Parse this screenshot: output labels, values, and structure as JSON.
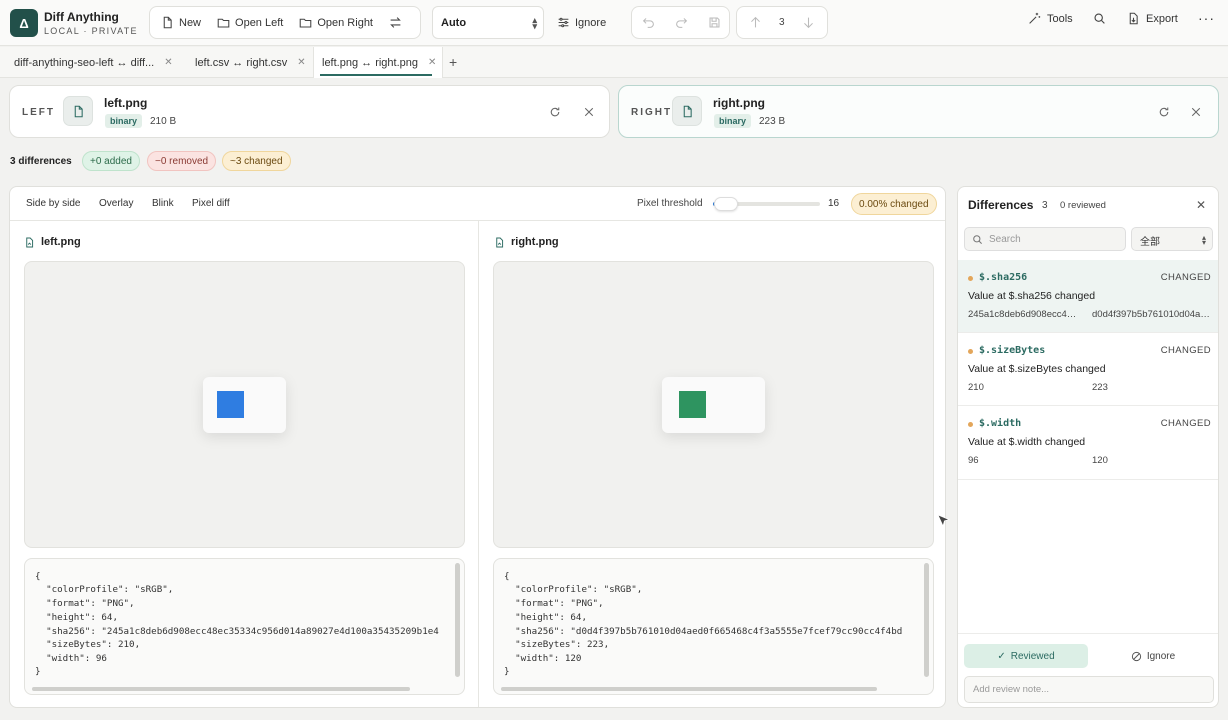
{
  "app": {
    "logo_glyph": "Δ",
    "title": "Diff Anything",
    "subtitle": "LOCAL · PRIVATE"
  },
  "toolbar": {
    "new_label": "New",
    "open_left_label": "Open Left",
    "open_right_label": "Open Right",
    "mode_select": "Auto",
    "ignore_label": "Ignore",
    "diff_index": "3",
    "tools_label": "Tools",
    "export_label": "Export"
  },
  "tabs": [
    {
      "label": "diff-anything-seo-left ↔ diff...",
      "active": false
    },
    {
      "label": "left.csv ↔ right.csv",
      "active": false
    },
    {
      "label": "left.png ↔ right.png",
      "active": true
    }
  ],
  "left_file": {
    "side": "LEFT",
    "name": "left.png",
    "type": "binary",
    "size": "210 B"
  },
  "right_file": {
    "side": "RIGHT",
    "name": "right.png",
    "type": "binary",
    "size": "223 B"
  },
  "summary": {
    "title": "3 differences",
    "added": "+0 added",
    "removed": "−0 removed",
    "changed": "~3 changed"
  },
  "view_modes": [
    "Side by side",
    "Overlay",
    "Blink",
    "Pixel diff"
  ],
  "pixel_threshold": {
    "label": "Pixel threshold",
    "value": "16",
    "changed": "0.00% changed"
  },
  "left_pane": {
    "title": "left.png",
    "swatch_color": "#2f7de1",
    "json": [
      "{",
      "  \"colorProfile\": \"sRGB\",",
      "  \"format\": \"PNG\",",
      "  \"height\": 64,",
      "  \"sha256\": \"245a1c8deb6d908ecc48ec35334c956d014a89027e4d100a35435209b1e4",
      "  \"sizeBytes\": 210,",
      "  \"width\": 96",
      "}"
    ]
  },
  "right_pane": {
    "title": "right.png",
    "swatch_color": "#2e9460",
    "json": [
      "{",
      "  \"colorProfile\": \"sRGB\",",
      "  \"format\": \"PNG\",",
      "  \"height\": 64,",
      "  \"sha256\": \"d0d4f397b5b761010d04aed0f665468c4f3a5555e7fcef79cc90cc4f4bd",
      "  \"sizeBytes\": 223,",
      "  \"width\": 120",
      "}"
    ]
  },
  "sidebar": {
    "title": "Differences",
    "count": "3",
    "reviewed": "0 reviewed",
    "search_placeholder": "Search",
    "filter_value": "全部",
    "items": [
      {
        "path": "$.sha256",
        "type": "CHANGED",
        "message": "Value at $.sha256 changed",
        "old": "245a1c8deb6d908ecc48ec35334c956d014a89027e4d100a35435209b1e4",
        "new": "d0d4f397b5b761010d04aed0f665468c4f3a5555e7fcef79cc90cc4f4bd"
      },
      {
        "path": "$.sizeBytes",
        "type": "CHANGED",
        "message": "Value at $.sizeBytes changed",
        "old": "210",
        "new": "223"
      },
      {
        "path": "$.width",
        "type": "CHANGED",
        "message": "Value at $.width changed",
        "old": "96",
        "new": "120"
      }
    ],
    "reviewed_button": "Reviewed",
    "ignore_button": "Ignore",
    "note_placeholder": "Add review note..."
  },
  "colors": {
    "accent": "#2c6b62",
    "added_bg": "#dff3e7",
    "removed_bg": "#fbe3e1",
    "changed_bg": "#fcefd3"
  }
}
